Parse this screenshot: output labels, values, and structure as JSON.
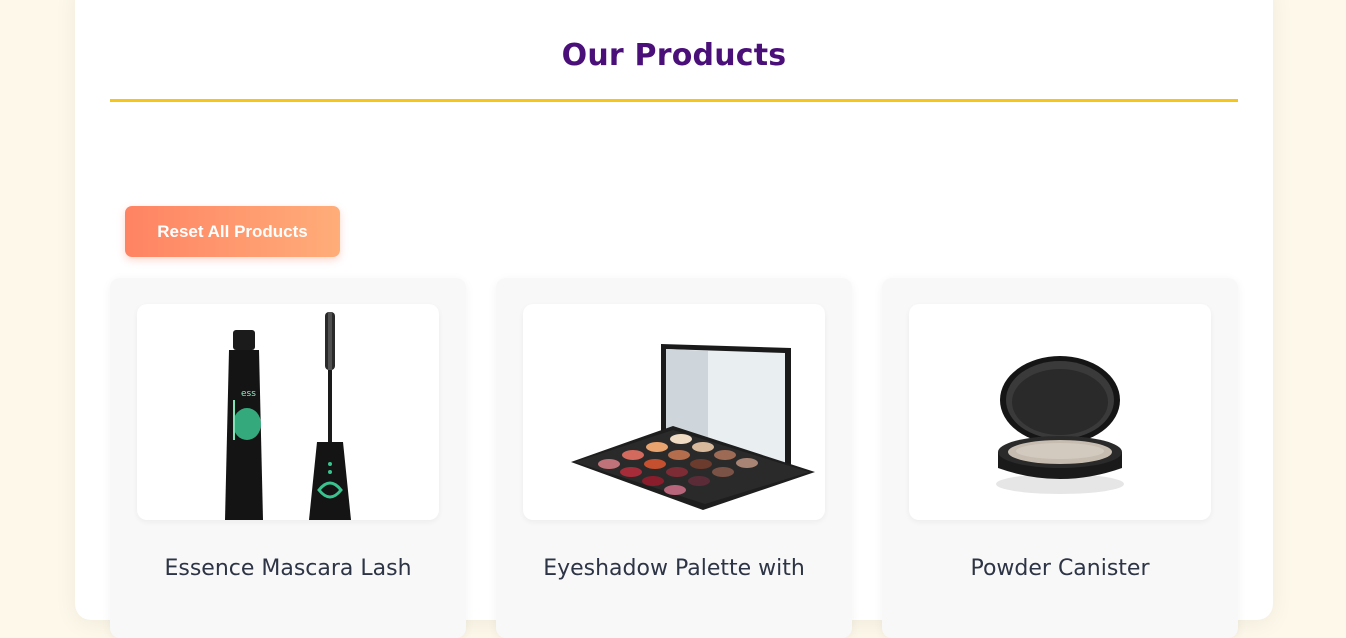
{
  "header": {
    "title": "Our Products"
  },
  "actions": {
    "reset_label": "Reset All Products"
  },
  "products": [
    {
      "name": "Essence Mascara Lash",
      "image_icon": "mascara-image"
    },
    {
      "name": "Eyeshadow Palette with",
      "image_icon": "eyeshadow-palette-image"
    },
    {
      "name": "Powder Canister",
      "image_icon": "powder-compact-image"
    }
  ],
  "colors": {
    "page_background": "#fdf8ea",
    "title": "#4b0f7a",
    "underline": "#f5c518",
    "button_gradient_start": "#ff8363",
    "button_gradient_end": "#ffad79",
    "product_name": "#2d3445"
  }
}
